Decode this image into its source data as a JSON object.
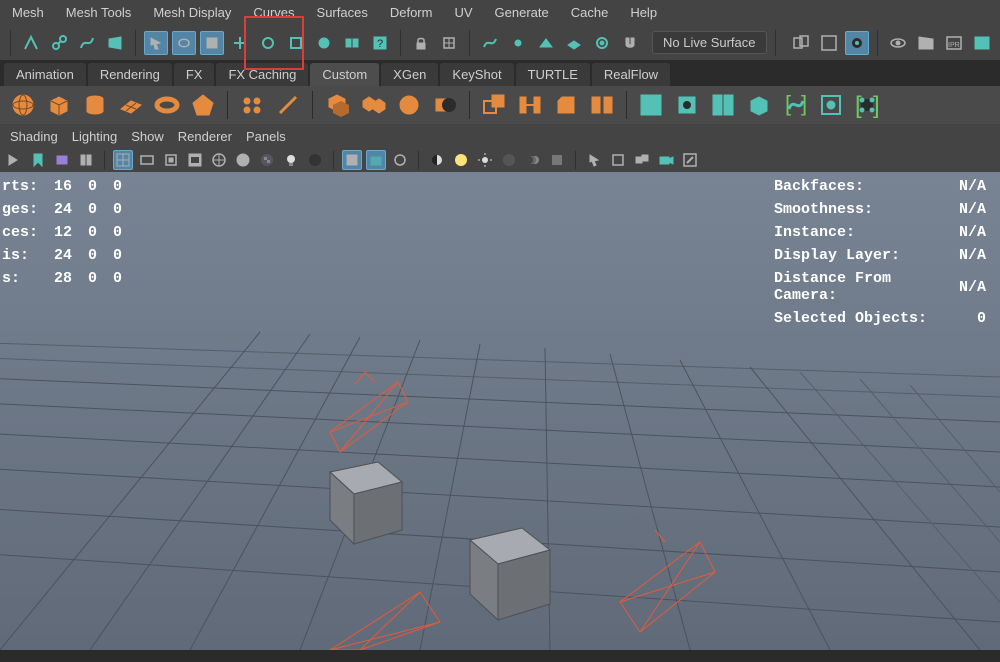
{
  "colors": {
    "accent_orange": "#e58b3f",
    "accent_teal": "#53c1b5",
    "accent_green": "#6fc95f",
    "red": "#de3c3c"
  },
  "menubar": {
    "items": [
      "Mesh",
      "Mesh Tools",
      "Mesh Display",
      "Curves",
      "Surfaces",
      "Deform",
      "UV",
      "Generate",
      "Cache",
      "Help"
    ]
  },
  "toolbar1": {
    "live_surface_label": "No Live Surface"
  },
  "shelf_tabs": {
    "items": [
      "Animation",
      "Rendering",
      "FX",
      "FX Caching",
      "Custom",
      "XGen",
      "KeyShot",
      "TURTLE",
      "RealFlow"
    ],
    "active": 4
  },
  "panel_menu": {
    "items": [
      "Shading",
      "Lighting",
      "Show",
      "Renderer",
      "Panels"
    ]
  },
  "hud_left": {
    "rows": [
      {
        "label": "rts:",
        "a": 16,
        "b": 0,
        "c": 0
      },
      {
        "label": "ges:",
        "a": 24,
        "b": 0,
        "c": 0
      },
      {
        "label": "ces:",
        "a": 12,
        "b": 0,
        "c": 0
      },
      {
        "label": "is:",
        "a": 24,
        "b": 0,
        "c": 0
      },
      {
        "label": "s:",
        "a": 28,
        "b": 0,
        "c": 0
      }
    ]
  },
  "hud_right": {
    "rows": [
      {
        "label": "Backfaces:",
        "val": "N/A"
      },
      {
        "label": "Smoothness:",
        "val": "N/A"
      },
      {
        "label": "Instance:",
        "val": "N/A"
      },
      {
        "label": "Display Layer:",
        "val": "N/A"
      },
      {
        "label": "Distance From Camera:",
        "val": "N/A"
      },
      {
        "label": "Selected Objects:",
        "val": "0"
      }
    ]
  }
}
